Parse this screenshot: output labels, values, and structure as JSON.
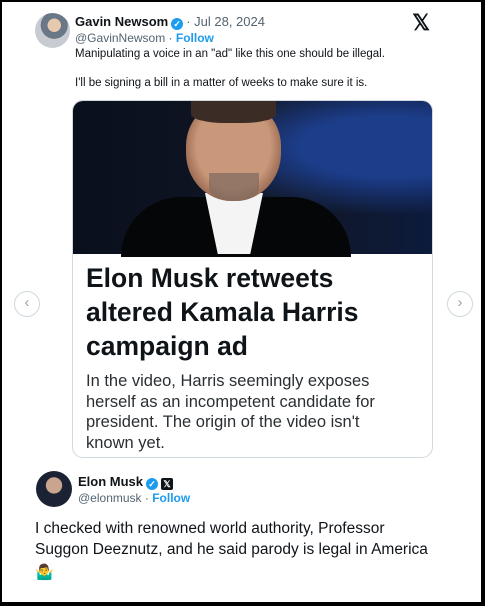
{
  "tweet1": {
    "name": "Gavin Newsom",
    "date": "· Jul 28, 2024",
    "handle": "@GavinNewsom",
    "follow": "Follow",
    "line1": "Manipulating a voice in an \"ad\" like this one should be illegal.",
    "line2": "I'll be signing a bill in a matter of weeks to make sure it is.",
    "card": {
      "title_lines": [
        "Elon Musk retweets",
        "altered Kamala Harris",
        "campaign ad"
      ],
      "desc_lines": [
        "In the video, Harris seemingly exposes",
        "herself as an incompetent candidate for",
        "president. The origin of the video isn't",
        "known yet."
      ]
    }
  },
  "tweet2": {
    "name": "Elon Musk",
    "handle": "@elonmusk",
    "follow": "Follow",
    "lines": [
      "I checked with renowned world authority, Professor",
      "Suggon Deeznutz, and he said parody is legal in America"
    ],
    "emoji": "🤷‍♂️"
  },
  "icons": {
    "verified": "✓",
    "x_logo": "𝕏",
    "prev": "‹",
    "next": "›"
  },
  "colors": {
    "link": "#1d9bf0",
    "verified": "#1d9bf0"
  }
}
